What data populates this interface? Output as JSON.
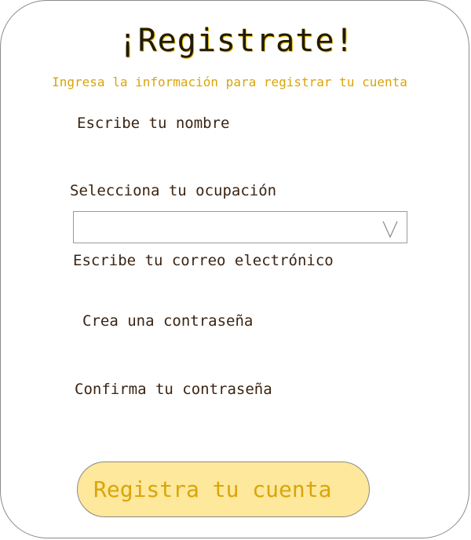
{
  "form": {
    "title": "¡Registrate!",
    "subtitle": "Ingresa la información para registrar tu cuenta",
    "name_label": "Escribe tu nombre",
    "occupation_label": "Selecciona tu ocupación",
    "occupation_value": "",
    "email_label": "Escribe tu correo electrónico",
    "password_label": "Crea una contraseña",
    "confirm_password_label": "Confirma tu contraseña",
    "submit_label": "Registra tu cuenta"
  },
  "colors": {
    "title_glow": "#f0c000",
    "subtitle": "#d9a50a",
    "label": "#3b2412",
    "button_bg": "#fde89b",
    "button_text": "#d9a50a"
  },
  "icons": {
    "occupation_select": "chevron-down-icon"
  }
}
